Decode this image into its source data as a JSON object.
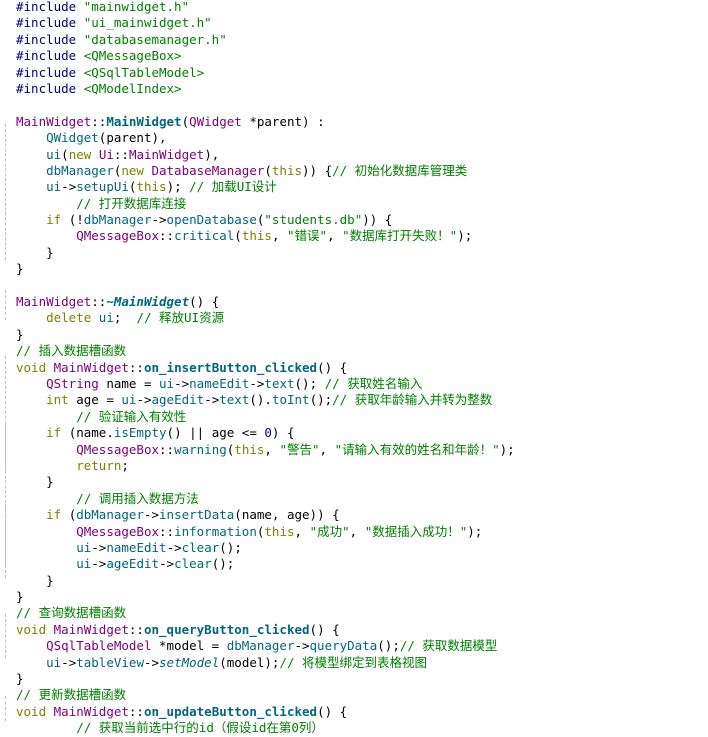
{
  "editor": {
    "language": "cpp",
    "colors": {
      "background": "#ffffff",
      "preprocessor": "#000080",
      "string": "#008000",
      "keyword": "#808000",
      "type": "#800080",
      "function": "#00677c",
      "comment": "#008000",
      "number": "#000080",
      "text": "#000000"
    },
    "lines": [
      [
        [
          "pp",
          "#include "
        ],
        [
          "str",
          "\"mainwidget.h\""
        ]
      ],
      [
        [
          "pp",
          "#include "
        ],
        [
          "str",
          "\"ui_mainwidget.h\""
        ]
      ],
      [
        [
          "pp",
          "#include "
        ],
        [
          "str",
          "\"databasemanager.h\""
        ]
      ],
      [
        [
          "pp",
          "#include "
        ],
        [
          "str",
          "<QMessageBox>"
        ]
      ],
      [
        [
          "pp",
          "#include "
        ],
        [
          "str",
          "<QSqlTableModel>"
        ]
      ],
      [
        [
          "pp",
          "#include "
        ],
        [
          "str",
          "<QModelIndex>"
        ]
      ],
      [],
      [
        [
          "type",
          "MainWidget"
        ],
        [
          "pl",
          "::"
        ],
        [
          "defn",
          "MainWidget"
        ],
        [
          "pl",
          "("
        ],
        [
          "type",
          "QWidget"
        ],
        [
          "pl",
          " *parent) :"
        ]
      ],
      [
        [
          "pl",
          "    "
        ],
        [
          "fn",
          "QWidget"
        ],
        [
          "pl",
          "(parent),"
        ]
      ],
      [
        [
          "pl",
          "    "
        ],
        [
          "fn",
          "ui"
        ],
        [
          "pl",
          "("
        ],
        [
          "kw",
          "new"
        ],
        [
          "pl",
          " "
        ],
        [
          "type",
          "Ui"
        ],
        [
          "pl",
          "::"
        ],
        [
          "type",
          "MainWidget"
        ],
        [
          "pl",
          "),"
        ]
      ],
      [
        [
          "pl",
          "    "
        ],
        [
          "fn",
          "dbManager"
        ],
        [
          "pl",
          "("
        ],
        [
          "kw",
          "new"
        ],
        [
          "pl",
          " "
        ],
        [
          "type",
          "DatabaseManager"
        ],
        [
          "pl",
          "("
        ],
        [
          "kw",
          "this"
        ],
        [
          "pl",
          ")) {"
        ],
        [
          "cm",
          "// 初始化数据库管理类"
        ]
      ],
      [
        [
          "pl",
          "    "
        ],
        [
          "fn",
          "ui"
        ],
        [
          "pl",
          "->"
        ],
        [
          "fn",
          "setupUi"
        ],
        [
          "pl",
          "("
        ],
        [
          "kw",
          "this"
        ],
        [
          "pl",
          "); "
        ],
        [
          "cm",
          "// 加载UI设计"
        ]
      ],
      [
        [
          "pl",
          "        "
        ],
        [
          "cm",
          "// 打开数据库连接"
        ]
      ],
      [
        [
          "pl",
          "    "
        ],
        [
          "kw",
          "if"
        ],
        [
          "pl",
          " (!"
        ],
        [
          "fn",
          "dbManager"
        ],
        [
          "pl",
          "->"
        ],
        [
          "fn",
          "openDatabase"
        ],
        [
          "pl",
          "("
        ],
        [
          "str",
          "\"students.db\""
        ],
        [
          "pl",
          ")) {"
        ]
      ],
      [
        [
          "pl",
          "        "
        ],
        [
          "type",
          "QMessageBox"
        ],
        [
          "pl",
          "::"
        ],
        [
          "fn",
          "critical"
        ],
        [
          "pl",
          "("
        ],
        [
          "kw",
          "this"
        ],
        [
          "pl",
          ", "
        ],
        [
          "str",
          "\"错误\""
        ],
        [
          "pl",
          ", "
        ],
        [
          "str",
          "\"数据库打开失败！\""
        ],
        [
          "pl",
          ");"
        ]
      ],
      [
        [
          "pl",
          "    }"
        ]
      ],
      [
        [
          "pl",
          "}"
        ]
      ],
      [],
      [
        [
          "type",
          "MainWidget"
        ],
        [
          "pl",
          "::"
        ],
        [
          "dtor",
          "~MainWidget"
        ],
        [
          "pl",
          "() {"
        ]
      ],
      [
        [
          "pl",
          "    "
        ],
        [
          "kw",
          "delete"
        ],
        [
          "pl",
          " "
        ],
        [
          "fn",
          "ui"
        ],
        [
          "pl",
          ";  "
        ],
        [
          "cm",
          "// 释放UI资源"
        ]
      ],
      [
        [
          "pl",
          "}"
        ]
      ],
      [
        [
          "cm",
          "// 插入数据槽函数"
        ]
      ],
      [
        [
          "kw",
          "void"
        ],
        [
          "pl",
          " "
        ],
        [
          "type",
          "MainWidget"
        ],
        [
          "pl",
          "::"
        ],
        [
          "defn",
          "on_insertButton_clicked"
        ],
        [
          "pl",
          "() {"
        ]
      ],
      [
        [
          "pl",
          "    "
        ],
        [
          "type",
          "QString"
        ],
        [
          "pl",
          " name = "
        ],
        [
          "fn",
          "ui"
        ],
        [
          "pl",
          "->"
        ],
        [
          "fn",
          "nameEdit"
        ],
        [
          "pl",
          "->"
        ],
        [
          "fn",
          "text"
        ],
        [
          "pl",
          "(); "
        ],
        [
          "cm",
          "// 获取姓名输入"
        ]
      ],
      [
        [
          "pl",
          "    "
        ],
        [
          "kw",
          "int"
        ],
        [
          "pl",
          " age = "
        ],
        [
          "fn",
          "ui"
        ],
        [
          "pl",
          "->"
        ],
        [
          "fn",
          "ageEdit"
        ],
        [
          "pl",
          "->"
        ],
        [
          "fn",
          "text"
        ],
        [
          "pl",
          "()."
        ],
        [
          "fn",
          "toInt"
        ],
        [
          "pl",
          "();"
        ],
        [
          "cm",
          "// 获取年龄输入并转为整数"
        ]
      ],
      [
        [
          "pl",
          "        "
        ],
        [
          "cm",
          "// 验证输入有效性"
        ]
      ],
      [
        [
          "pl",
          "    "
        ],
        [
          "kw",
          "if"
        ],
        [
          "pl",
          " (name."
        ],
        [
          "fn",
          "isEmpty"
        ],
        [
          "pl",
          "() || age <= "
        ],
        [
          "num",
          "0"
        ],
        [
          "pl",
          ") {"
        ]
      ],
      [
        [
          "pl",
          "        "
        ],
        [
          "type",
          "QMessageBox"
        ],
        [
          "pl",
          "::"
        ],
        [
          "fn",
          "warning"
        ],
        [
          "pl",
          "("
        ],
        [
          "kw",
          "this"
        ],
        [
          "pl",
          ", "
        ],
        [
          "str",
          "\"警告\""
        ],
        [
          "pl",
          ", "
        ],
        [
          "str",
          "\"请输入有效的姓名和年龄！\""
        ],
        [
          "pl",
          ");"
        ]
      ],
      [
        [
          "pl",
          "        "
        ],
        [
          "kw",
          "return"
        ],
        [
          "pl",
          ";"
        ]
      ],
      [
        [
          "pl",
          "    }"
        ]
      ],
      [
        [
          "pl",
          "        "
        ],
        [
          "cm",
          "// 调用插入数据方法"
        ]
      ],
      [
        [
          "pl",
          "    "
        ],
        [
          "kw",
          "if"
        ],
        [
          "pl",
          " ("
        ],
        [
          "fn",
          "dbManager"
        ],
        [
          "pl",
          "->"
        ],
        [
          "fn",
          "insertData"
        ],
        [
          "pl",
          "(name, age)) {"
        ]
      ],
      [
        [
          "pl",
          "        "
        ],
        [
          "type",
          "QMessageBox"
        ],
        [
          "pl",
          "::"
        ],
        [
          "fn",
          "information"
        ],
        [
          "pl",
          "("
        ],
        [
          "kw",
          "this"
        ],
        [
          "pl",
          ", "
        ],
        [
          "str",
          "\"成功\""
        ],
        [
          "pl",
          ", "
        ],
        [
          "str",
          "\"数据插入成功！\""
        ],
        [
          "pl",
          ");"
        ]
      ],
      [
        [
          "pl",
          "        "
        ],
        [
          "fn",
          "ui"
        ],
        [
          "pl",
          "->"
        ],
        [
          "fn",
          "nameEdit"
        ],
        [
          "pl",
          "->"
        ],
        [
          "fn",
          "clear"
        ],
        [
          "pl",
          "();"
        ]
      ],
      [
        [
          "pl",
          "        "
        ],
        [
          "fn",
          "ui"
        ],
        [
          "pl",
          "->"
        ],
        [
          "fn",
          "ageEdit"
        ],
        [
          "pl",
          "->"
        ],
        [
          "fn",
          "clear"
        ],
        [
          "pl",
          "();"
        ]
      ],
      [
        [
          "pl",
          "    }"
        ]
      ],
      [
        [
          "pl",
          "}"
        ]
      ],
      [
        [
          "cm",
          "// 查询数据槽函数"
        ]
      ],
      [
        [
          "kw",
          "void"
        ],
        [
          "pl",
          " "
        ],
        [
          "type",
          "MainWidget"
        ],
        [
          "pl",
          "::"
        ],
        [
          "defn",
          "on_queryButton_clicked"
        ],
        [
          "pl",
          "() {"
        ]
      ],
      [
        [
          "pl",
          "    "
        ],
        [
          "type",
          "QSqlTableModel"
        ],
        [
          "pl",
          " *model = "
        ],
        [
          "fn",
          "dbManager"
        ],
        [
          "pl",
          "->"
        ],
        [
          "fn",
          "queryData"
        ],
        [
          "pl",
          "();"
        ],
        [
          "cm",
          "// 获取数据模型"
        ]
      ],
      [
        [
          "pl",
          "    "
        ],
        [
          "fn",
          "ui"
        ],
        [
          "pl",
          "->"
        ],
        [
          "fn",
          "tableView"
        ],
        [
          "pl",
          "->"
        ],
        [
          "vfn",
          "setModel"
        ],
        [
          "pl",
          "(model);"
        ],
        [
          "cm",
          "// 将模型绑定到表格视图"
        ]
      ],
      [
        [
          "pl",
          "}"
        ]
      ],
      [
        [
          "cm",
          "// 更新数据槽函数"
        ]
      ],
      [
        [
          "kw",
          "void"
        ],
        [
          "pl",
          " "
        ],
        [
          "type",
          "MainWidget"
        ],
        [
          "pl",
          "::"
        ],
        [
          "defn",
          "on_updateButton_clicked"
        ],
        [
          "pl",
          "() {"
        ]
      ],
      [
        [
          "pl",
          "        "
        ],
        [
          "cm",
          "// 获取当前选中行的id（假设id在第0列）"
        ]
      ]
    ]
  }
}
